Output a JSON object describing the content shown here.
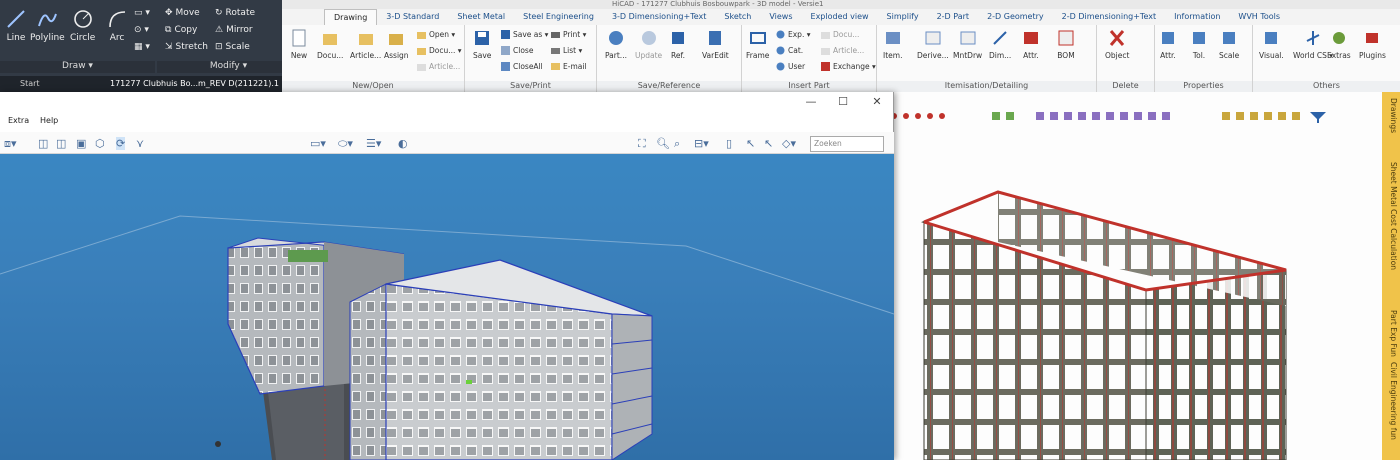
{
  "autocad": {
    "draw_tools": [
      "Line",
      "Polyline",
      "Circle",
      "Arc"
    ],
    "draw_panel_label": "Draw ▾",
    "modify_tools": [
      "Move",
      "Rotate",
      "Copy",
      "Mirror",
      "Stretch",
      "Scale"
    ],
    "modify_panel_label": "Modify ▾",
    "tab_start": "Start",
    "tab_file": "171277 Clubhuis Bo...m_REV D(211221).1"
  },
  "ribbon": {
    "title_text": "HiCAD - 171277 Clubhuis Bosbouwpark - 3D model - Versie1",
    "tabs": [
      "Drawing",
      "3-D Standard",
      "Sheet Metal",
      "Steel Engineering",
      "3-D Dimensioning+Text",
      "Sketch",
      "Views",
      "Exploded view",
      "Simplify",
      "2-D Part",
      "2-D Geometry",
      "2-D Dimensioning+Text",
      "Information",
      "WVH Tools"
    ],
    "groups": [
      "New/Open",
      "Save/Print",
      "Save/Reference",
      "Insert Part",
      "Itemisation/Detailing",
      "Delete",
      "Properties",
      "Others"
    ],
    "new_open": {
      "new": "New",
      "docu": "Docu...",
      "article": "Article...",
      "assign": "Assign",
      "open": "Open ▾",
      "docu2": "Docu... ▾",
      "article2": "Article..."
    },
    "save_print": {
      "save": "Save",
      "save_as": "Save as ▾",
      "close": "Close",
      "close_all": "CloseAll",
      "print": "Print ▾",
      "list": "List ▾",
      "email": "E-mail"
    },
    "save_ref": {
      "part": "Part...",
      "update": "Update",
      "ref": "Ref.",
      "varedit": "VarEdit"
    },
    "insert_part": {
      "frame": "Frame",
      "exp": "Exp. ▾",
      "cat": "Cat.",
      "user": "User",
      "docu": "Docu...",
      "article": "Article...",
      "exchange": "Exchange ▾"
    },
    "itemisation": {
      "item": "Item.",
      "derive": "Derive...",
      "mntdrw": "MntDrw",
      "dim": "Dim...",
      "attr": "Attr.",
      "bom": "BOM"
    },
    "delete": {
      "object": "Object"
    },
    "properties": {
      "attr": "Attr.",
      "tol": "Tol.",
      "scale": "Scale"
    },
    "others": {
      "visual": "Visual.",
      "world": "World CS ▾",
      "extras": "Extras",
      "plugins": "Plugins"
    }
  },
  "viewer": {
    "menu": [
      "Extra",
      "Help"
    ],
    "search_placeholder": "Zoeken",
    "controls": {
      "minimize": "—",
      "maximize": "☐",
      "close": "✕"
    }
  },
  "side_panel": {
    "labels": [
      "Drawings",
      "Sheet Metal Cost Calculation",
      "Part Exp Fun",
      "Civil Engineering fun"
    ]
  },
  "colors": {
    "accent": "#1c4f8a",
    "viewport_sky": "#3a87c2",
    "side_panel": "#f0c34a",
    "frame_red": "#c0322b"
  }
}
